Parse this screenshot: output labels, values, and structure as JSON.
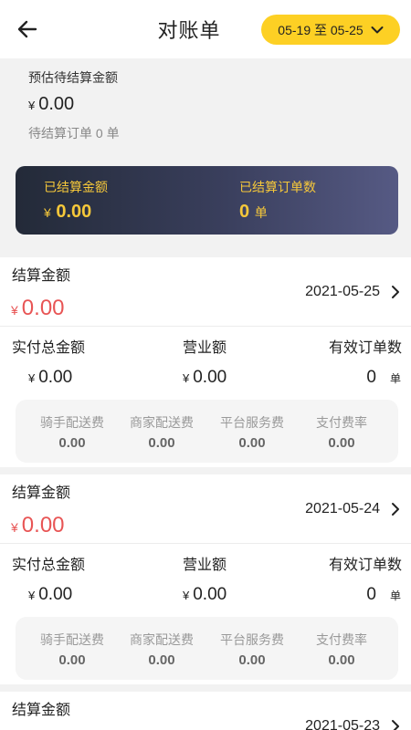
{
  "header": {
    "title": "对账单",
    "date_range": "05-19 至 05-25"
  },
  "summary": {
    "estimated_label": "预估待结算金额",
    "currency": "¥",
    "estimated_amount": "0.00",
    "pending_orders_text": "待结算订单 0 单",
    "settled_amount_label": "已结算金额",
    "settled_amount": "0.00",
    "settled_orders_label": "已结算订单数",
    "settled_orders": "0",
    "settled_orders_unit": "单"
  },
  "labels": {
    "settle_amount": "结算金额",
    "total_paid": "实付总金额",
    "revenue": "营业额",
    "valid_orders": "有效订单数",
    "order_unit": "单",
    "rider_fee": "骑手配送费",
    "merchant_fee": "商家配送费",
    "platform_fee": "平台服务费",
    "pay_rate": "支付费率"
  },
  "records": [
    {
      "date": "2021-05-25",
      "settle_amount": "0.00",
      "total_paid": "0.00",
      "revenue": "0.00",
      "valid_orders": "0",
      "rider_fee": "0.00",
      "merchant_fee": "0.00",
      "platform_fee": "0.00",
      "pay_rate": "0.00"
    },
    {
      "date": "2021-05-24",
      "settle_amount": "0.00",
      "total_paid": "0.00",
      "revenue": "0.00",
      "valid_orders": "0",
      "rider_fee": "0.00",
      "merchant_fee": "0.00",
      "platform_fee": "0.00",
      "pay_rate": "0.00"
    },
    {
      "date": "2021-05-23"
    }
  ]
}
